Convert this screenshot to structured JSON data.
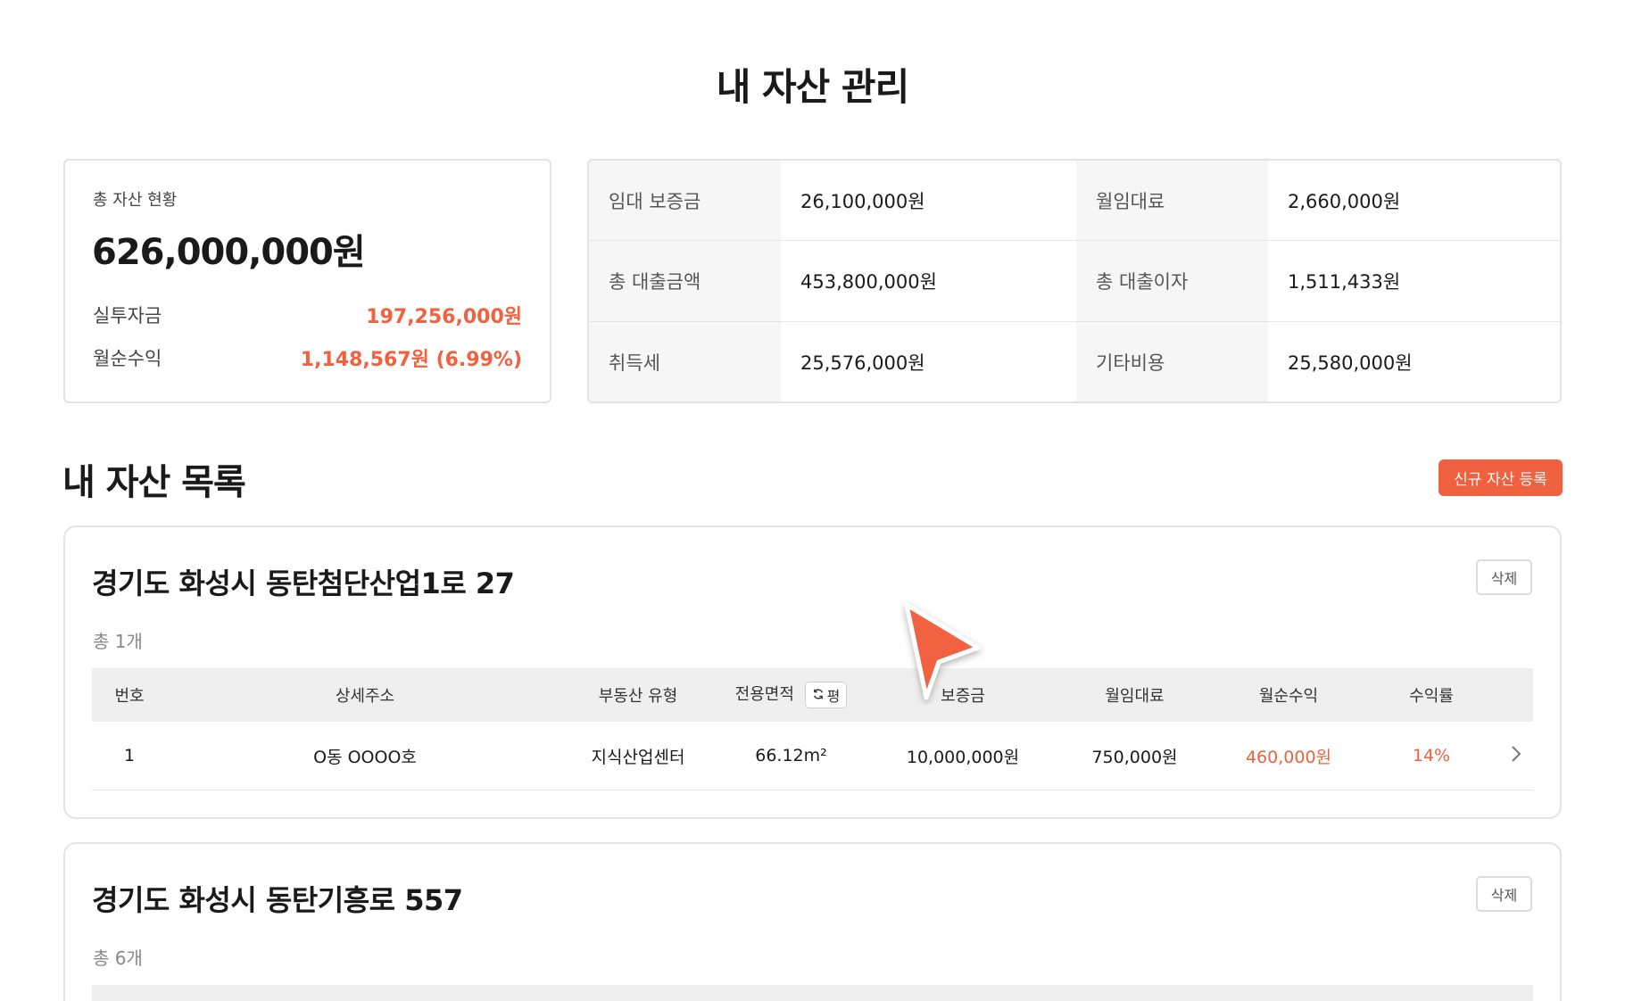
{
  "page": {
    "title": "내 자산 관리"
  },
  "summary": {
    "label": "총 자산 현황",
    "total": "626,000,000원",
    "rows": [
      {
        "label": "실투자금",
        "value": "197,256,000원"
      },
      {
        "label": "월순수익",
        "value": "1,148,567원 (6.99%)"
      }
    ]
  },
  "stats": {
    "rows": [
      {
        "k1": "임대 보증금",
        "v1": "26,100,000원",
        "k2": "월임대료",
        "v2": "2,660,000원"
      },
      {
        "k1": "총 대출금액",
        "v1": "453,800,000원",
        "k2": "총 대출이자",
        "v2": "1,511,433원"
      },
      {
        "k1": "취득세",
        "v1": "25,576,000원",
        "k2": "기타비용",
        "v2": "25,580,000원"
      }
    ]
  },
  "list": {
    "title": "내 자산 목록",
    "register_label": "신규 자산 등록"
  },
  "table_headers": {
    "no": "번호",
    "address": "상세주소",
    "type": "부동산 유형",
    "area": "전용면적",
    "unit": "평",
    "deposit": "보증금",
    "rent": "월임대료",
    "net": "월순수익",
    "yield": "수익률"
  },
  "assets": [
    {
      "title": "경기도 화성시 동탄첨단산업1로 27",
      "delete_label": "삭제",
      "count": "총 1개",
      "rows": [
        {
          "no": "1",
          "address": "O동 OOOO호",
          "type": "지식산업센터",
          "area": "66.12m²",
          "deposit": "10,000,000원",
          "rent": "750,000원",
          "net": "460,000원",
          "yield": "14%"
        }
      ]
    },
    {
      "title": "경기도 화성시 동탄기흥로 557",
      "delete_label": "삭제",
      "count": "총 6개"
    }
  ],
  "colors": {
    "accent": "#f0623f",
    "header_bg": "#efefef",
    "border": "#e3e3e3"
  },
  "icons": {
    "unit_toggle": "refresh-icon",
    "row_arrow": "chevron-right-icon",
    "pointer": "cursor-arrow-icon"
  }
}
